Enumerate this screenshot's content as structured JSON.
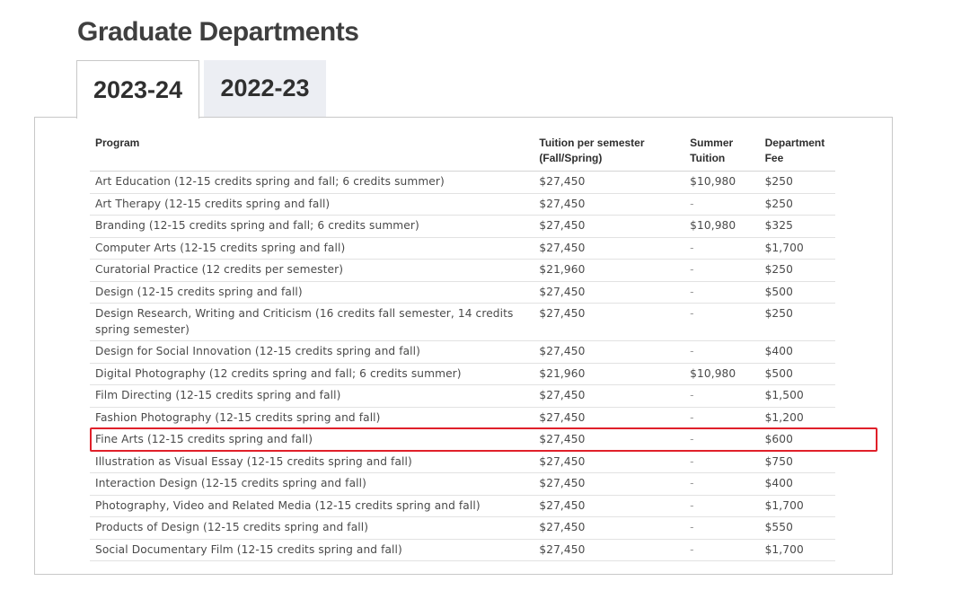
{
  "page": {
    "title": "Graduate Departments"
  },
  "tabs": [
    {
      "label": "2023-24",
      "active": true
    },
    {
      "label": "2022-23",
      "active": false
    }
  ],
  "table": {
    "headers": {
      "program": "Program",
      "tuition_line1": "Tuition per semester",
      "tuition_line2": "(Fall/Spring)",
      "summer_line1": "Summer",
      "summer_line2": "Tuition",
      "fee_line1": "Department",
      "fee_line2": "Fee"
    },
    "rows": [
      {
        "program": "Art Education (12-15 credits spring and fall; 6 credits summer)",
        "tuition": "$27,450",
        "summer": "$10,980",
        "fee": "$250"
      },
      {
        "program": "Art Therapy (12-15 credits spring and fall)",
        "tuition": "$27,450",
        "summer": "-",
        "fee": "$250"
      },
      {
        "program": "Branding (12-15 credits spring and fall; 6 credits summer)",
        "tuition": "$27,450",
        "summer": "$10,980",
        "fee": "$325"
      },
      {
        "program": "Computer Arts (12-15 credits spring and fall)",
        "tuition": "$27,450",
        "summer": "-",
        "fee": "$1,700"
      },
      {
        "program": "Curatorial Practice (12 credits per semester)",
        "tuition": "$21,960",
        "summer": "-",
        "fee": "$250"
      },
      {
        "program": "Design (12-15 credits spring and fall)",
        "tuition": "$27,450",
        "summer": "-",
        "fee": "$500"
      },
      {
        "program": "Design Research, Writing and Criticism (16 credits fall semester, 14 credits spring semester)",
        "tuition": "$27,450",
        "summer": "-",
        "fee": "$250"
      },
      {
        "program": "Design for Social Innovation (12-15 credits spring and fall)",
        "tuition": "$27,450",
        "summer": "-",
        "fee": "$400"
      },
      {
        "program": "Digital Photography (12 credits spring and fall; 6 credits summer)",
        "tuition": "$21,960",
        "summer": "$10,980",
        "fee": "$500"
      },
      {
        "program": "Film Directing (12-15 credits spring and fall)",
        "tuition": "$27,450",
        "summer": "-",
        "fee": "$1,500"
      },
      {
        "program": "Fashion Photography (12-15 credits spring and fall)",
        "tuition": "$27,450",
        "summer": "-",
        "fee": "$1,200"
      },
      {
        "program": "Fine Arts (12-15 credits spring and fall)",
        "tuition": "$27,450",
        "summer": "-",
        "fee": "$600"
      },
      {
        "program": "Illustration as Visual Essay (12-15 credits spring and fall)",
        "tuition": "$27,450",
        "summer": "-",
        "fee": "$750"
      },
      {
        "program": "Interaction Design (12-15 credits spring and fall)",
        "tuition": "$27,450",
        "summer": "-",
        "fee": "$400"
      },
      {
        "program": "Photography, Video and Related Media (12-15 credits spring and fall)",
        "tuition": "$27,450",
        "summer": "-",
        "fee": "$1,700"
      },
      {
        "program": "Products of Design (12-15 credits spring and fall)",
        "tuition": "$27,450",
        "summer": "-",
        "fee": "$550"
      },
      {
        "program": "Social Documentary Film (12-15 credits spring and fall)",
        "tuition": "$27,450",
        "summer": "-",
        "fee": "$1,700"
      }
    ]
  },
  "highlight": {
    "row_index": 11,
    "color": "#e0202a"
  },
  "colors": {
    "inactive_tab_bg": "#eceef3",
    "border": "#c8c8c8"
  }
}
